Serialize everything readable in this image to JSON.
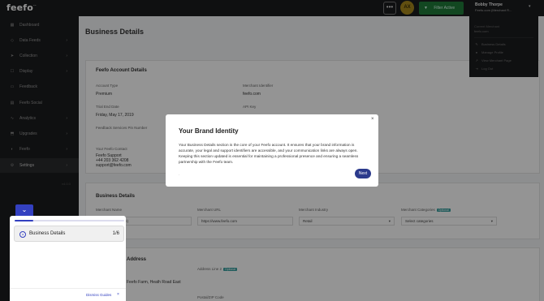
{
  "app": {
    "logo": "feefo",
    "logo_mark": "ᵉᵒ"
  },
  "topbar": {
    "more_label": "•••",
    "brand_initials": "AX",
    "filter_label": "Filter Active",
    "user_name": "Bobby Thorpe",
    "user_sub": "Feefo.com (Merchant R..."
  },
  "user_menu": {
    "merchant_label": "Current Merchant",
    "merchant_value": "feefo.com",
    "items": [
      "Business Details",
      "Manage Profile",
      "View Merchant Page",
      "Log Out"
    ]
  },
  "sidebar": {
    "items": [
      {
        "label": "Dashboard",
        "icon": "grid-icon",
        "chev": false
      },
      {
        "label": "Data Feeds",
        "icon": "tag-icon",
        "chev": true
      },
      {
        "label": "Collection",
        "icon": "send-icon",
        "chev": true
      },
      {
        "label": "Display",
        "icon": "display-icon",
        "chev": true
      },
      {
        "label": "Feedback",
        "icon": "chat-icon",
        "chev": false
      },
      {
        "label": "Feefo Social",
        "icon": "social-icon",
        "chev": false
      },
      {
        "label": "Analytics",
        "icon": "chart-icon",
        "chev": true
      },
      {
        "label": "Upgrades",
        "icon": "upgrade-icon",
        "chev": true
      },
      {
        "label": "Feefo",
        "icon": "feefo-icon",
        "chev": true
      },
      {
        "label": "Settings",
        "icon": "gear-icon",
        "chev": true
      }
    ],
    "footer": "v4.0.0"
  },
  "main": {
    "title": "Business Details",
    "account": {
      "title": "Feefo Account Details",
      "account_type_label": "Account Type",
      "account_type_value": "Premium",
      "merchant_identifier_label": "Merchant Identifier",
      "merchant_identifier_value": "feefo.com",
      "trial_end_label": "Trial End Date",
      "trial_end_value": "Friday, May 17, 2019",
      "api_key_label": "API Key",
      "feedback_label": "Feedback Services Pin Number",
      "support_label": "Your Feefo Contact",
      "support_name": "Feefo Support",
      "support_phone": "+44 203 362 4208",
      "support_email": "support@feefo.com"
    },
    "business": {
      "title": "Business Details",
      "merchant_name_label": "Merchant Name",
      "merchant_name_value": "(Merchant Name)",
      "merchant_url_label": "Merchant URL",
      "merchant_url_value": "https://www.feefo.com",
      "industry_label": "Merchant Industry",
      "industry_value": "Retail",
      "categories_label": "Merchant Categories",
      "categories_tag": "Optional",
      "categories_placeholder": "Select categories"
    },
    "address": {
      "title": "Address",
      "line2_label": "Address Line 2",
      "line2_tag": "Optional",
      "line1_value": "Feefo Farm, Heath Road East",
      "postcode_label": "Postal/ZIP Code"
    }
  },
  "modal": {
    "title": "Your Brand Identity",
    "body": "Your Business Details section is the core of your Feefo account. It ensures that your brand information is accurate, your legal and support identifiers are accessible, and your communication links are always open. Keeping this section updated is essential for maintaining a professional presence and ensuring a seamless partnership with the Feefo team.",
    "close": "×",
    "next_label": "Next",
    "dot": "."
  },
  "guide": {
    "toggle_icon": "⌄",
    "step_label": "Business Details",
    "step_count": "1/6",
    "progress": 0.17,
    "dismiss_label": "Dismiss Guides",
    "dismiss_x": "×"
  }
}
